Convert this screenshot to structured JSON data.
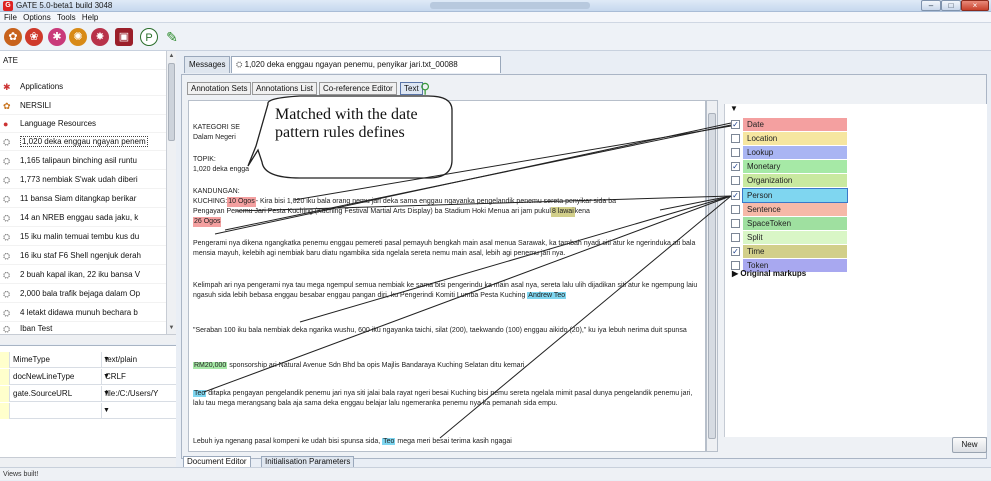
{
  "window": {
    "title": "GATE 5.0-beta1 build 3048",
    "app_icon": "G"
  },
  "menu": {
    "items": [
      "File",
      "Options",
      "Tools",
      "Help"
    ]
  },
  "left_tree": {
    "root": "ATE",
    "items": [
      {
        "label": "Applications",
        "type": "folder"
      },
      {
        "label": "NERSILI",
        "type": "app"
      },
      {
        "label": "Language Resources",
        "type": "folder"
      },
      {
        "label": "1,020 deka enggau ngayan penem",
        "type": "doc",
        "selected": true
      },
      {
        "label": "1,165 talipaun binching asil runtu",
        "type": "doc"
      },
      {
        "label": "1,773 nembiak S'wak udah diberi",
        "type": "doc"
      },
      {
        "label": "11 bansa Siam ditangkap berikar",
        "type": "doc"
      },
      {
        "label": "14 an NREB enggau sada jaku, k",
        "type": "doc"
      },
      {
        "label": "15 iku malin temuai tembu kus du",
        "type": "doc"
      },
      {
        "label": "16 iku staf F6 Shell ngenjuk derah",
        "type": "doc"
      },
      {
        "label": "2 buah kapal ikan, 22 iku bansa V",
        "type": "doc"
      },
      {
        "label": "2,000 bala trafik bejaga dalam Op",
        "type": "doc"
      },
      {
        "label": "4 letakt didawa munuh bechara b",
        "type": "doc"
      },
      {
        "label": "Iban Test",
        "type": "corpus"
      }
    ]
  },
  "features": [
    {
      "name": "MimeType",
      "value": "text/plain"
    },
    {
      "name": "docNewLineType",
      "value": "CRLF"
    },
    {
      "name": "gate.SourceURL",
      "value": "file:/C:/Users/Y"
    },
    {
      "name": "",
      "value": ""
    }
  ],
  "status": {
    "text": "Views built!"
  },
  "top_tabs": {
    "messages": "Messages",
    "document": "1,020 deka enggau ngayan penemu, penyikar jari.txt_00088"
  },
  "subtoolbar": {
    "annotation_sets": "Annotation Sets",
    "annotations_list": "Annotations List",
    "coreference": "Co-reference Editor",
    "text": "Text"
  },
  "document_text": {
    "l1a": "KATEGORI SE",
    "l1b": "Dalam Negeri",
    "l2a": "TOPIK:",
    "l2b": "1,020 deka engga",
    "l3a": "KANDUNGAN:",
    "p1_pre": "KUCHING: ",
    "p1_date1": "10 Ogos",
    "p1_mid": " - Kira bisi 1,020 iku bala orang nemu jari deka sama enggau ngayanka pengelandik penemu sereta penyikar sida ba",
    "p1_line2": "Pengayan Penemu Jari Pesta Kuching (Kuching Festival Martial Arts Display) ba Stadium Hoki Menua ari jam pukul ",
    "p1_time": "8 lawai",
    "p1_line2b": " kena",
    "p1_date2": "26 Ogos",
    "p2": "Pengerami nya dikena ngangkatka penemu enggau pemereti pasal pemayuh bengkah main asal menua Sarawak, ka tambah nyadi siti atur ke ngerinduka ati bala mensia mayuh, kelebih agi nembiak baru diatu ngambika sida ngelala sereta nemu main asal, lebih agi penemu jari nya.",
    "p3": "Kelimpah ari nya pengerami nya tau mega ngempul semua nembiak ke sama bisi pengerindu ka main asal nya, sereta lalu ulih dijadikan siti atur ke ngempung laiu ngasuh sida lebih bebasa enggau besabar enggau pangan diri, ku Pengerindi Komiti Lumba Pesta Kuching ",
    "p3_person": "Andrew Teo",
    "p4": "\"Seraban 100 iku bala nembiak deka ngarika wushu, 600 iku ngayanka taichi, silat (200), taekwando (100) enggau aikido (20),\" ku iya lebuh nerima duit spunsa",
    "p5_money": "RM20,000",
    "p5": " sponsorship ari Natural Avenue Sdn Bhd ba opis Majlis Bandaraya Kuching Selatan ditu kemari.",
    "p6_person": "Teo",
    "p6": " ditapka pengayan pengelandik penemu jari nya siti jalai bala rayat ngeri besai Kuching bisi nemu sereta ngelala mimit pasal dunya pengelandik penemu jari, lalu tau mega merangsang bala aja sama deka enggau belajar lalu ngemeranka penemu nya ka pemanah sida empu.",
    "p7_pre": "Lebuh iya ngenang pasal kompeni ke udah bisi spunsa sida, ",
    "p7_person": "Teo",
    "p7": " mega meri besai terima kasih ngagai"
  },
  "callout": {
    "text": "Matched with the date pattern rules defines"
  },
  "annotation_types": [
    {
      "label": "Date",
      "checked": true,
      "color": "#f4a0a0"
    },
    {
      "label": "Location",
      "checked": false,
      "color": "#f6e6a0"
    },
    {
      "label": "Lookup",
      "checked": false,
      "color": "#a9b5f3"
    },
    {
      "label": "Monetary",
      "checked": true,
      "color": "#a6e9a6"
    },
    {
      "label": "Organization",
      "checked": false,
      "color": "#c9e9a0"
    },
    {
      "label": "Person",
      "checked": true,
      "color": "#7fd6f0"
    },
    {
      "label": "Sentence",
      "checked": false,
      "color": "#f6b9a8"
    },
    {
      "label": "SpaceToken",
      "checked": false,
      "color": "#9fe0a0"
    },
    {
      "label": "Split",
      "checked": false,
      "color": "#d9f6c6"
    },
    {
      "label": "Time",
      "checked": true,
      "color": "#d2cf8a"
    },
    {
      "label": "Token",
      "checked": false,
      "color": "#a8a8f0"
    }
  ],
  "original_markups": "Original markups",
  "new_button": "New",
  "bottom_tabs": {
    "editor": "Document Editor",
    "params": "Initialisation Parameters"
  }
}
